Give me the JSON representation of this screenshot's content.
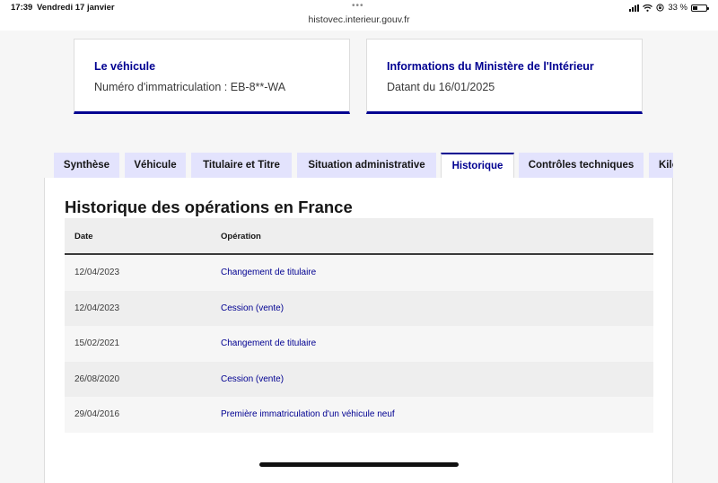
{
  "status_bar": {
    "time": "17:39",
    "date": "Vendredi 17 janvier",
    "url": "histovec.interieur.gouv.fr",
    "battery": "33 %",
    "battery_level_percent": 33
  },
  "cards": {
    "vehicule": {
      "title": "Le véhicule",
      "text": "Numéro d'immatriculation : EB-8**-WA"
    },
    "ministere": {
      "title": "Informations du Ministère de l'Intérieur",
      "text": "Datant du 16/01/2025"
    }
  },
  "tabs": [
    {
      "label": "Synthèse",
      "active": false
    },
    {
      "label": "Véhicule",
      "active": false
    },
    {
      "label": "Titulaire et Titre",
      "active": false
    },
    {
      "label": "Situation administrative",
      "active": false
    },
    {
      "label": "Historique",
      "active": true
    },
    {
      "label": "Contrôles techniques",
      "active": false
    },
    {
      "label": "Kilométrage",
      "active": false
    }
  ],
  "history": {
    "title": "Historique des opérations en France",
    "columns": {
      "date": "Date",
      "operation": "Opération"
    },
    "rows": [
      {
        "date": "12/04/2023",
        "operation": "Changement de titulaire"
      },
      {
        "date": "12/04/2023",
        "operation": "Cession (vente)"
      },
      {
        "date": "15/02/2021",
        "operation": "Changement de titulaire"
      },
      {
        "date": "26/08/2020",
        "operation": "Cession (vente)"
      },
      {
        "date": "29/04/2016",
        "operation": "Première immatriculation d'un véhicule neuf"
      }
    ]
  },
  "colors": {
    "accent": "#000091",
    "tab_bg": "#e3e3fd"
  }
}
